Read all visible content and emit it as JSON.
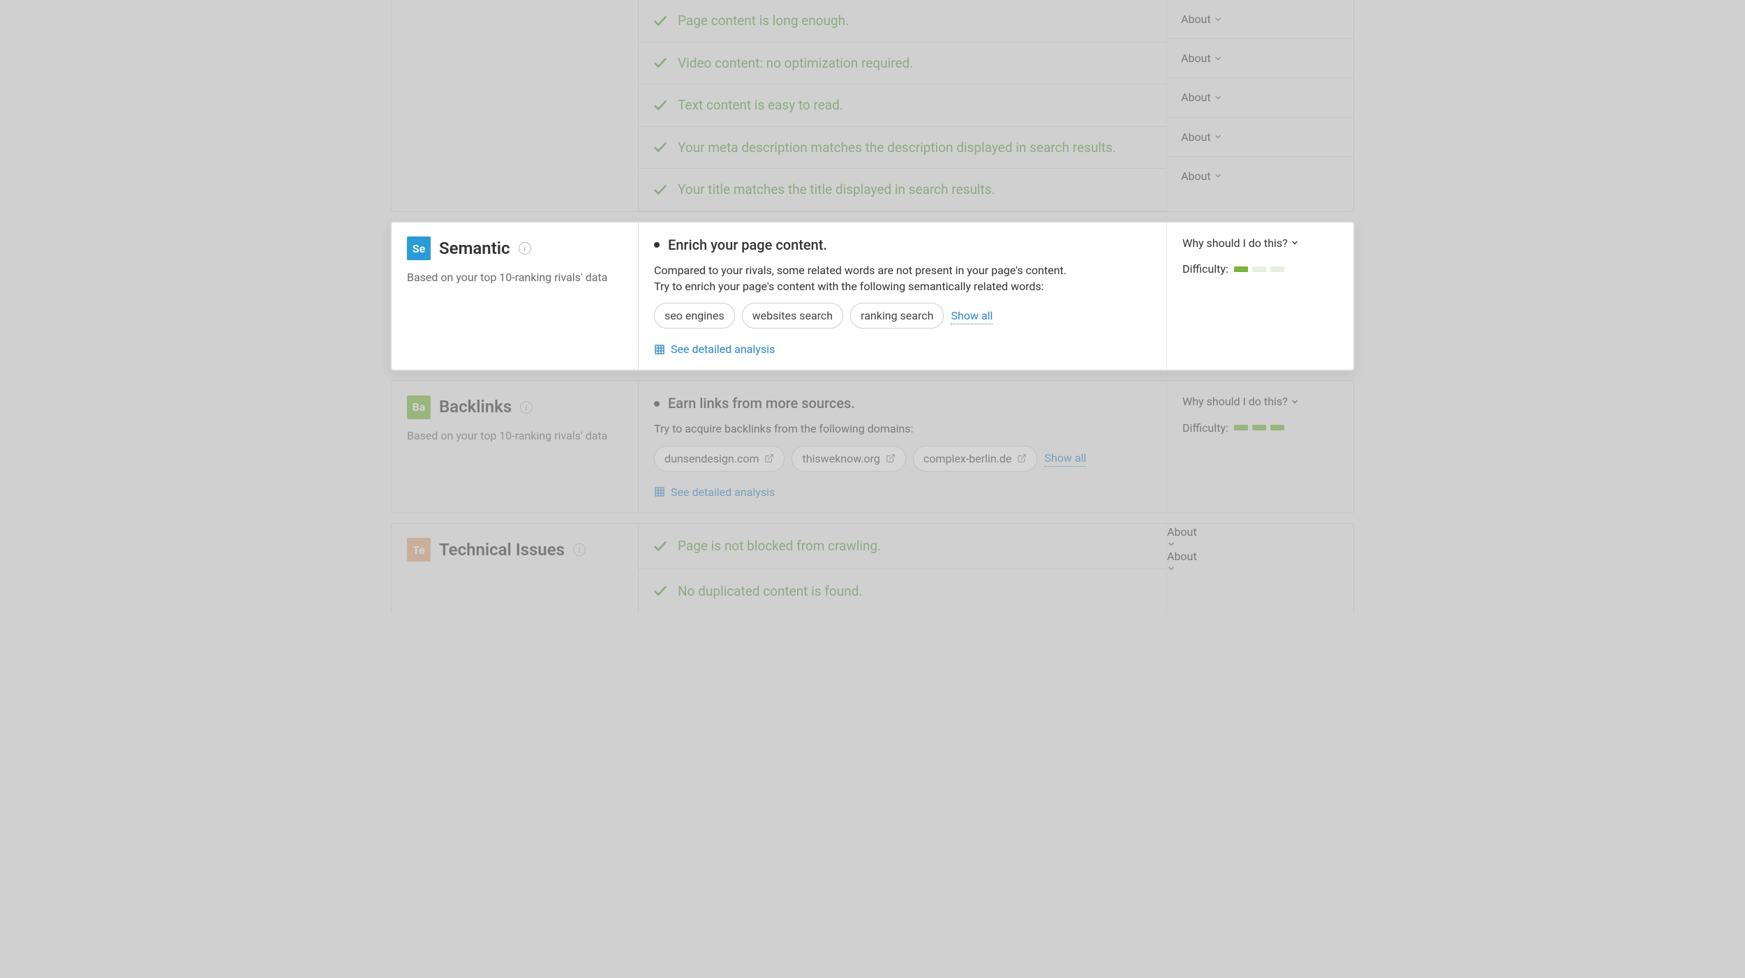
{
  "common": {
    "about_label": "About",
    "why_label": "Why should I do this?",
    "difficulty_label": "Difficulty:",
    "show_all": "Show all",
    "see_detailed": "See detailed analysis",
    "rivals_note": "Based on your top 10-ranking rivals' data"
  },
  "top_checks": [
    "Page content is long enough.",
    "Video content: no optimization required.",
    "Text content is easy to read.",
    "Your meta description matches the description displayed in search results.",
    "Your title matches the title displayed in search results."
  ],
  "semantic": {
    "badge": "Se",
    "title": "Semantic",
    "headline": "Enrich your page content.",
    "desc1": "Compared to your rivals, some related words are not present in your page's content.",
    "desc2": "Try to enrich your page's content with the following semantically related words:",
    "chips": [
      "seo engines",
      "websites search",
      "ranking search"
    ],
    "difficulty_level": 1
  },
  "backlinks": {
    "badge": "Ba",
    "title": "Backlinks",
    "headline": "Earn links from more sources.",
    "desc": "Try to acquire backlinks from the following domains:",
    "chips": [
      "dunsendesign.com",
      "thisweknow.org",
      "complex-berlin.de"
    ],
    "difficulty_level": 3
  },
  "technical": {
    "badge": "Te",
    "title": "Technical Issues",
    "checks": [
      "Page is not blocked from crawling.",
      "No duplicated content is found."
    ]
  }
}
